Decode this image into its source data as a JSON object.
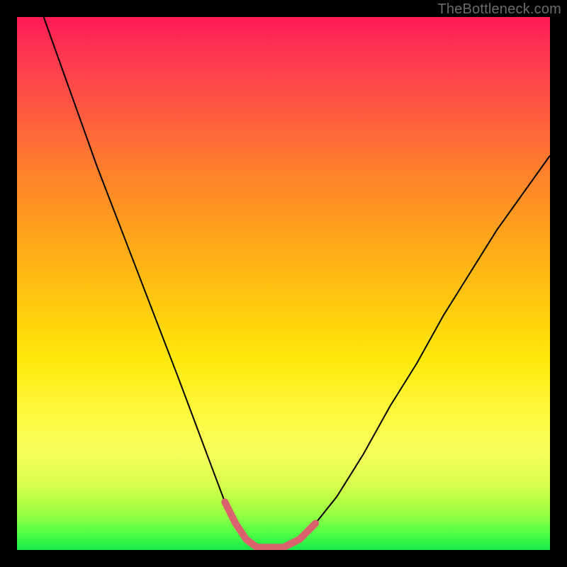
{
  "watermark": {
    "text": "TheBottleneck.com"
  },
  "chart_data": {
    "type": "line",
    "title": "",
    "xlabel": "",
    "ylabel": "",
    "xlim": [
      0,
      100
    ],
    "ylim": [
      0,
      100
    ],
    "legend": false,
    "grid": false,
    "background_gradient": {
      "direction": "vertical",
      "stops": [
        {
          "pos": 0,
          "color": "#ff1a55"
        },
        {
          "pos": 18,
          "color": "#ff5a40"
        },
        {
          "pos": 40,
          "color": "#ffa11c"
        },
        {
          "pos": 64,
          "color": "#ffe80a"
        },
        {
          "pos": 88,
          "color": "#d6ff4a"
        },
        {
          "pos": 100,
          "color": "#18e84a"
        }
      ]
    },
    "series": [
      {
        "name": "bottleneck-curve",
        "color": "#000000",
        "stroke_width": 2,
        "x": [
          5,
          10,
          15,
          20,
          25,
          30,
          33,
          36,
          39,
          41,
          43,
          45,
          48,
          50,
          53,
          56,
          60,
          65,
          70,
          75,
          80,
          85,
          90,
          95,
          100
        ],
        "values": [
          100,
          86,
          72,
          59,
          46,
          33,
          25,
          17,
          9,
          5,
          2,
          0.5,
          0.5,
          0.5,
          2,
          5,
          10,
          18,
          27,
          35,
          44,
          52,
          60,
          67,
          74
        ]
      },
      {
        "name": "optimal-highlight",
        "color": "#d9626d",
        "stroke_width": 10,
        "linecap": "round",
        "x": [
          39,
          41,
          43,
          45,
          48,
          50,
          53,
          56
        ],
        "values": [
          9,
          5,
          2,
          0.5,
          0.5,
          0.5,
          2,
          5
        ]
      }
    ],
    "annotations": []
  }
}
